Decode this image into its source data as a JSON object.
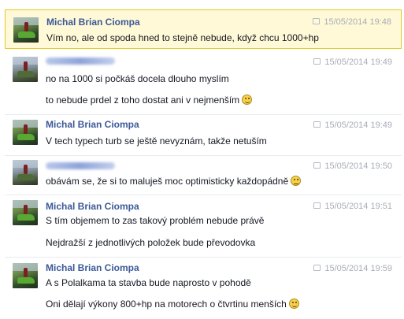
{
  "messages": [
    {
      "author": "Michal Brian Ciompa",
      "author_blurred": false,
      "timestamp": "15/05/2014 19:48",
      "lines": [
        "Vím no, ale od spoda hned to stejně nebude, když chcu 1000+hp"
      ],
      "highlighted": true
    },
    {
      "author": "",
      "author_blurred": true,
      "timestamp": "15/05/2014 19:49",
      "lines": [
        "no na 1000 si počkáš docela dlouho myslím",
        "to nebude prdel z toho dostat ani v nejmenším"
      ],
      "emoji": "smile-emoji"
    },
    {
      "author": "Michal Brian Ciompa",
      "author_blurred": false,
      "timestamp": "15/05/2014 19:49",
      "lines": [
        "V tech typech turb se ještě nevyznám, takže netuším"
      ]
    },
    {
      "author": "",
      "author_blurred": true,
      "timestamp": "15/05/2014 19:50",
      "lines": [
        "obávám se, že si to maluješ moc optimisticky každopádně"
      ],
      "emoji": "smile-emoji"
    },
    {
      "author": "Michal Brian Ciompa",
      "author_blurred": false,
      "timestamp": "15/05/2014 19:51",
      "lines": [
        "S tím objemem to zas takový problém nebude právě",
        "Nejdražší z jednotlivých položek bude převodovka"
      ]
    },
    {
      "author": "Michal Brian Ciompa",
      "author_blurred": false,
      "timestamp": "15/05/2014 19:59",
      "lines": [
        "A s Polalkama ta stavba bude naprosto v pohodě",
        "Oni dělají výkony 800+hp na motorech o čtvrtinu menších"
      ],
      "emoji": "smile-emoji"
    }
  ],
  "colors": {
    "author_link": "#3b5998",
    "timestamp": "#a8adb7",
    "highlight_bg": "#fff9d7",
    "highlight_border": "#e2c822"
  }
}
